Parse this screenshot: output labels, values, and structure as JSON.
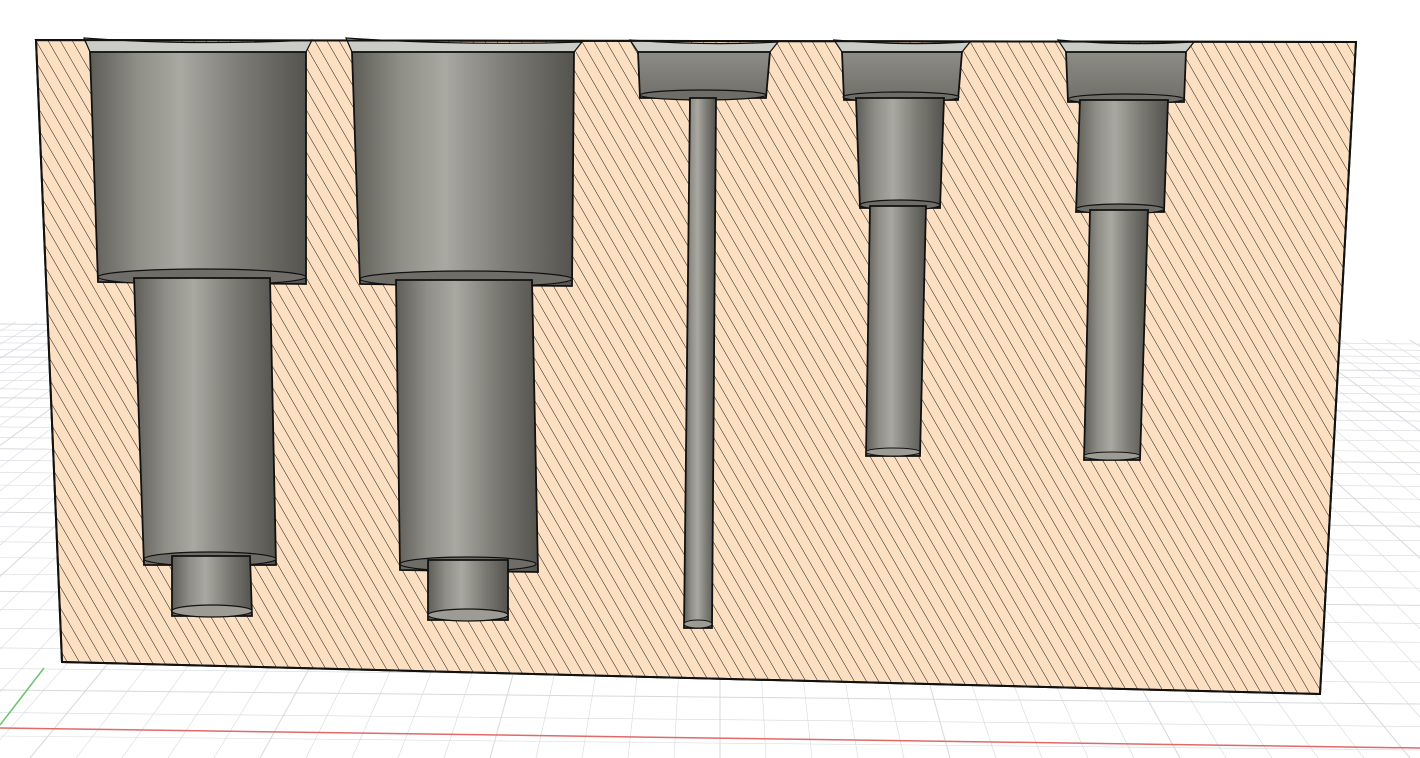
{
  "viewport": {
    "background_color": "#ffffff",
    "grid_color": "#d6d9dd",
    "x_axis_color": "#e06a6a",
    "y_axis_color": "#6cc46c"
  },
  "section_view": {
    "section_fill_color": "#fde0c2",
    "hatch_color": "#1a1a1a",
    "bore_shade_dark": "#5e5d57",
    "bore_shade_light": "#a9a8a1",
    "top_face_color": "#c3c7c2",
    "outline_color": "#111111",
    "hole_count": 5,
    "holes": [
      {
        "type": "counterbored stepped hole",
        "steps": 3
      },
      {
        "type": "counterbored stepped hole",
        "steps": 3
      },
      {
        "type": "counterbored through-pin hole",
        "steps": 2
      },
      {
        "type": "counterbored stepped hole",
        "steps": 3
      },
      {
        "type": "counterbored stepped hole",
        "steps": 3
      }
    ]
  }
}
